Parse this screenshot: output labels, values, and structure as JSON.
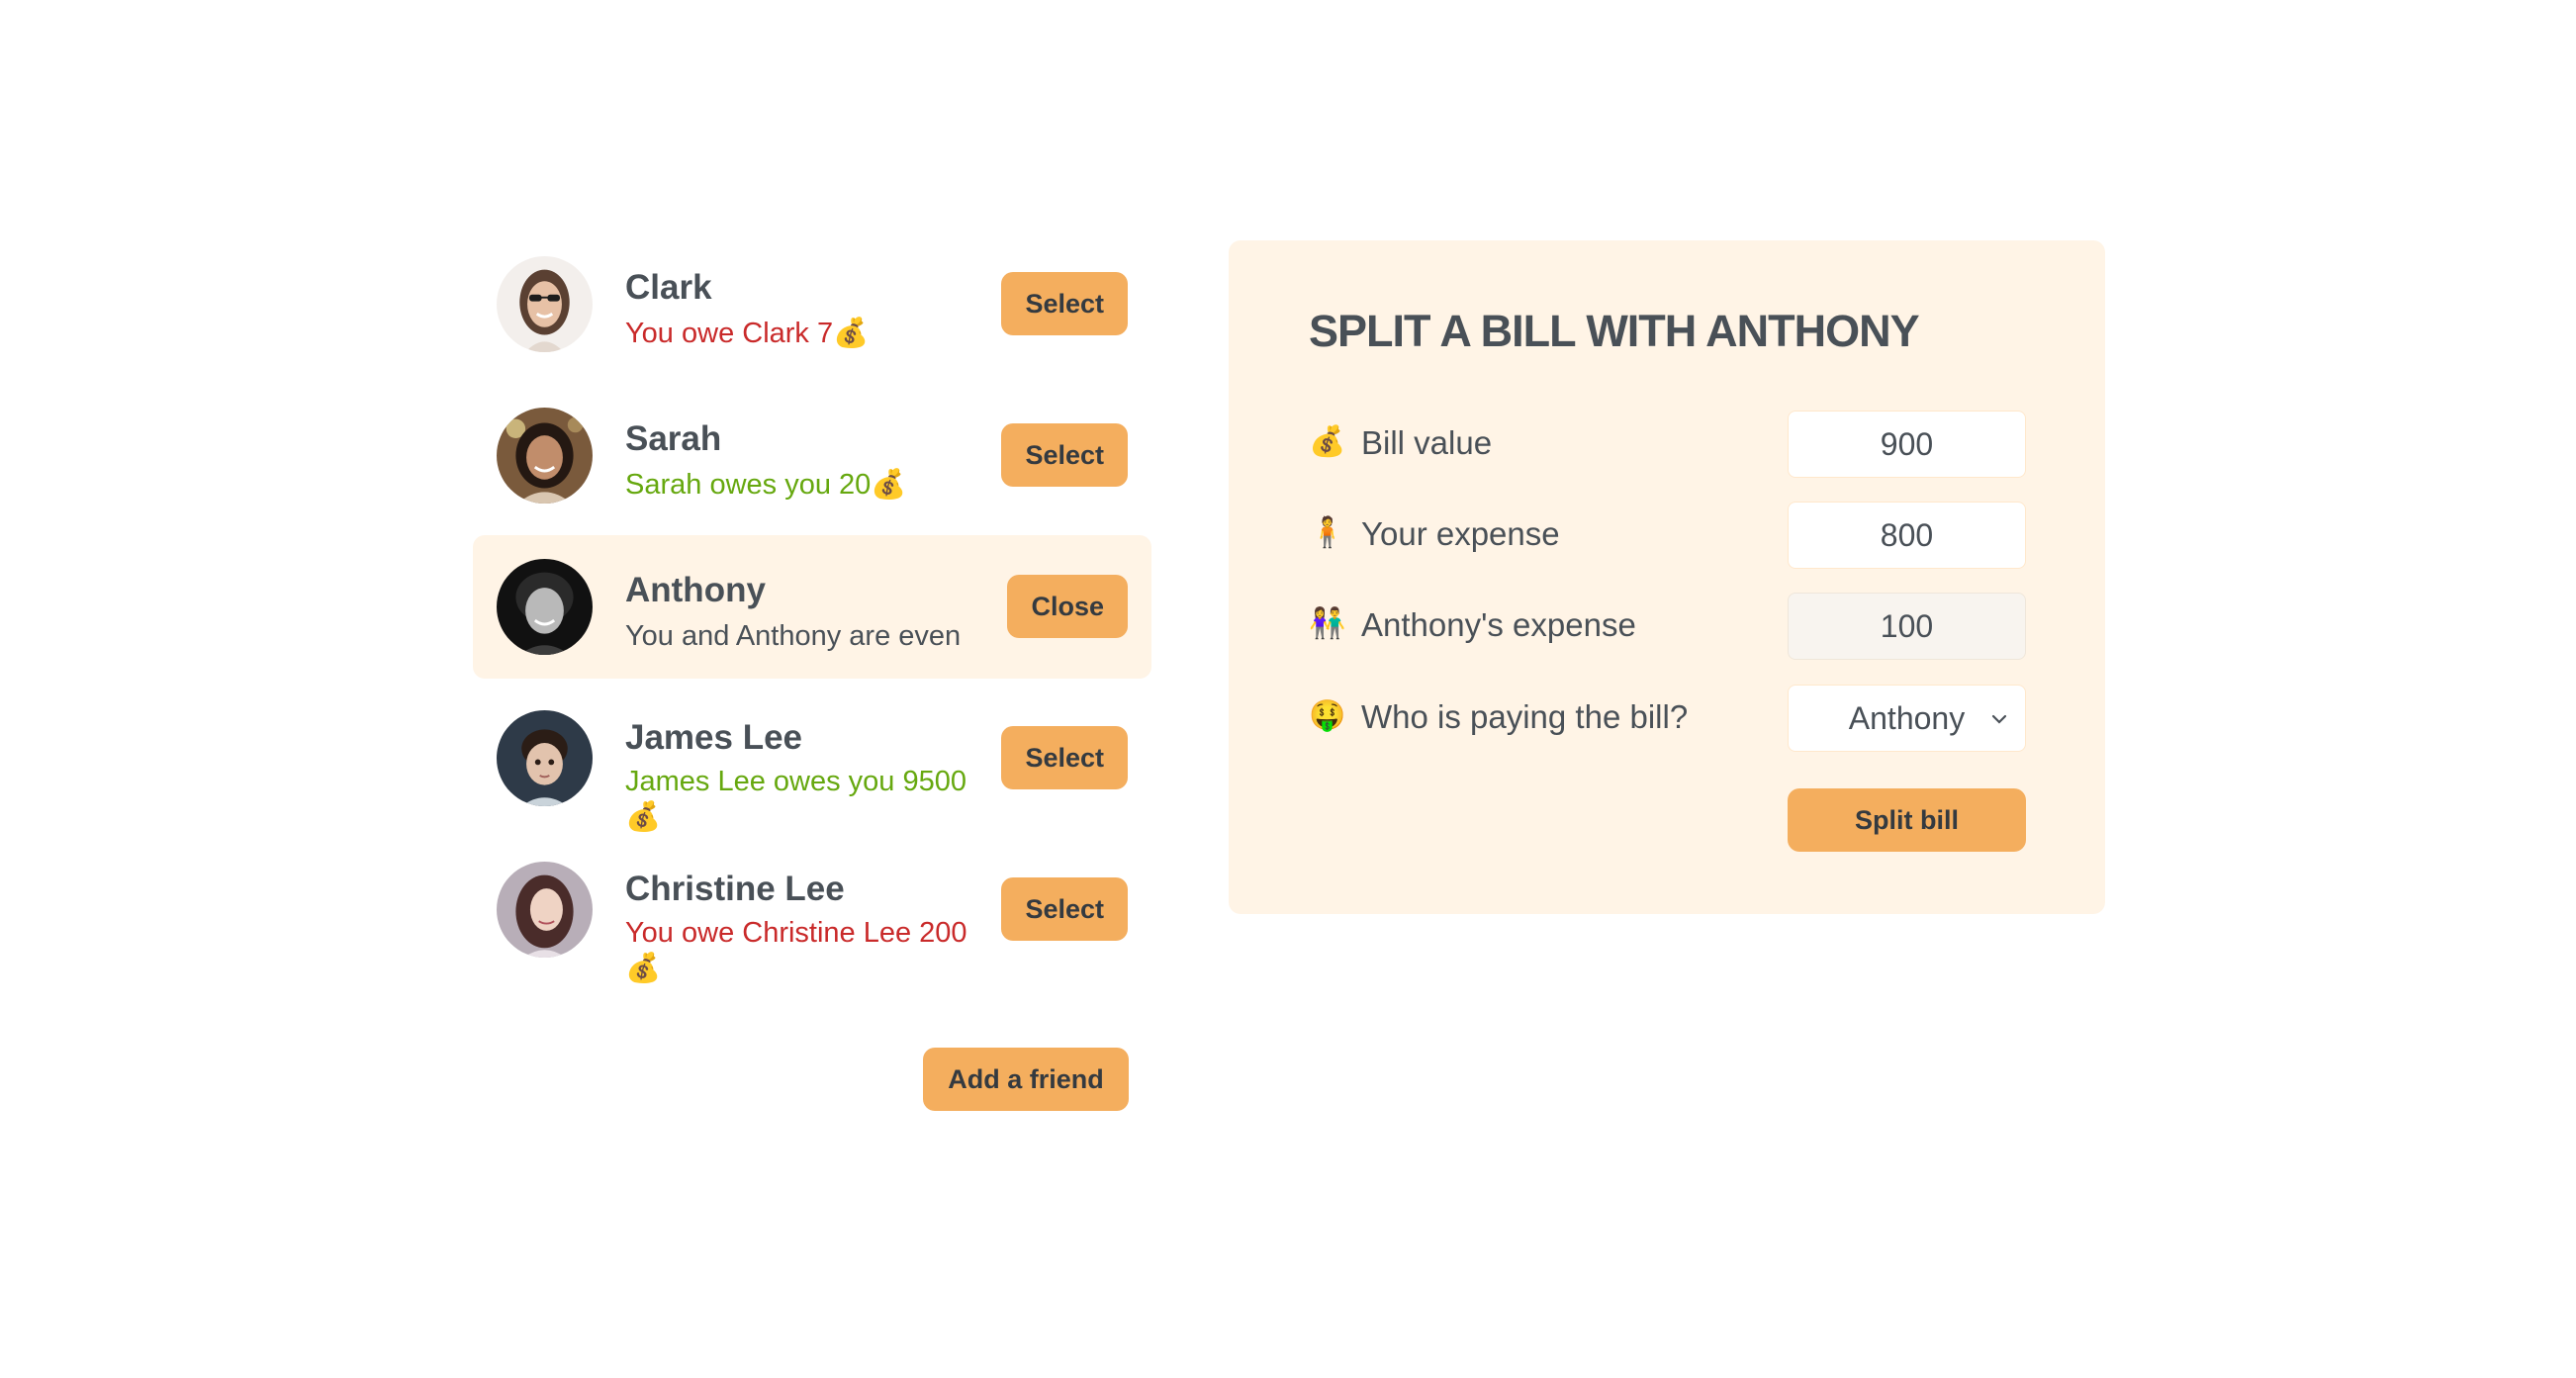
{
  "friends": [
    {
      "name": "Clark",
      "balance": "You owe Clark 7💰",
      "status": "neg",
      "button": "Select"
    },
    {
      "name": "Sarah",
      "balance": "Sarah owes you 20💰",
      "status": "pos",
      "button": "Select"
    },
    {
      "name": "Anthony",
      "balance": "You and Anthony are even",
      "status": "even",
      "button": "Close"
    },
    {
      "name": "James Lee",
      "balance": "James Lee owes you 9500 💰",
      "status": "pos",
      "button": "Select"
    },
    {
      "name": "Christine Lee",
      "balance": "You owe Christine Lee 200 💰",
      "status": "neg",
      "button": "Select"
    }
  ],
  "add_friend_label": "Add a friend",
  "form": {
    "title": "SPLIT A BILL WITH ANTHONY",
    "bill_value": {
      "icon": "💰",
      "label": "Bill value",
      "value": "900"
    },
    "your_expense": {
      "icon": "🧍",
      "label": "Your expense",
      "value": "800"
    },
    "friend_expense": {
      "icon": "👫",
      "label": "Anthony's expense",
      "value": "100"
    },
    "payer": {
      "icon": "🤑",
      "label": "Who is paying the bill?",
      "value": "Anthony"
    },
    "submit_label": "Split bill"
  },
  "colors": {
    "accent": "#f4ae5e",
    "selected_bg": "#fff4e6",
    "negative": "#c92a2a",
    "positive": "#66a80f",
    "text": "#495057"
  }
}
